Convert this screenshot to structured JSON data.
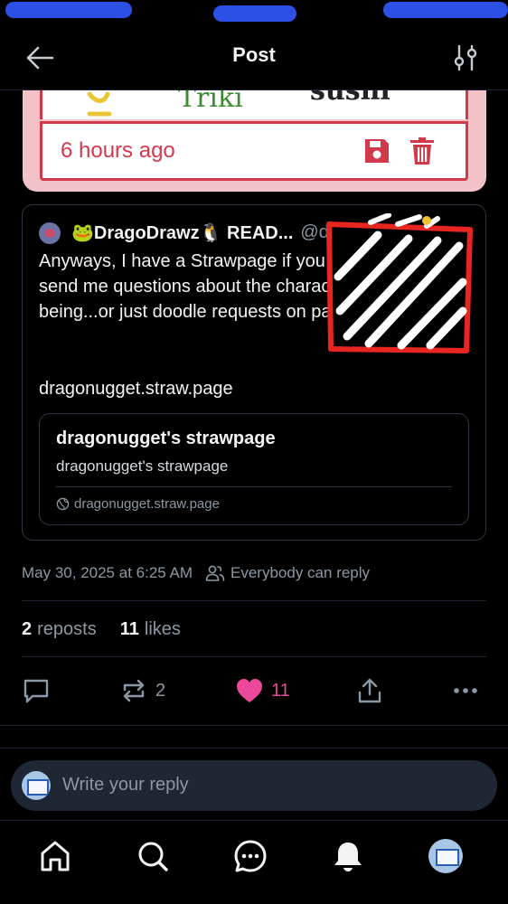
{
  "header": {
    "title": "Post"
  },
  "embed": {
    "scribble_left": "Triki",
    "scribble_right": "sushi",
    "time_ago": "6 hours ago"
  },
  "quote": {
    "author_name": "🐸DragoDrawz🐧 READ...",
    "author_handle": "@dragonu...",
    "text": "Anyways, I have a Strawpage if you guys want to send me questions about the characters for the time being...or just doodle requests on paper😁",
    "link_text": "dragonugget.straw.page",
    "link_card": {
      "title": "dragonugget's strawpage",
      "description": "dragonugget's strawpage",
      "url": "dragonugget.straw.page"
    }
  },
  "meta": {
    "timestamp": "May 30, 2025 at 6:25 AM",
    "reply_setting": "Everybody can reply"
  },
  "stats": {
    "reposts_count": "2",
    "reposts_label": "reposts",
    "likes_count": "11",
    "likes_label": "likes"
  },
  "actions": {
    "repost_count": "2",
    "like_count": "11"
  },
  "reply": {
    "placeholder": "Write your reply"
  },
  "colors": {
    "background": "#000000",
    "accent_like": "#ec4899",
    "muted": "#8b98a5",
    "embed_red": "#d23a4c",
    "embed_pink": "#f3c2c6"
  },
  "icons": {
    "back": "arrow-left-icon",
    "settings": "sliders-icon",
    "save": "floppy-disk-icon",
    "trash": "trash-icon",
    "reply": "comment-icon",
    "repost": "repost-icon",
    "like": "heart-icon",
    "share": "share-icon",
    "more": "ellipsis-icon",
    "home": "home-icon",
    "search": "search-icon",
    "chat": "chat-icon",
    "notifications": "bell-icon",
    "people": "people-icon",
    "globe": "globe-icon"
  }
}
